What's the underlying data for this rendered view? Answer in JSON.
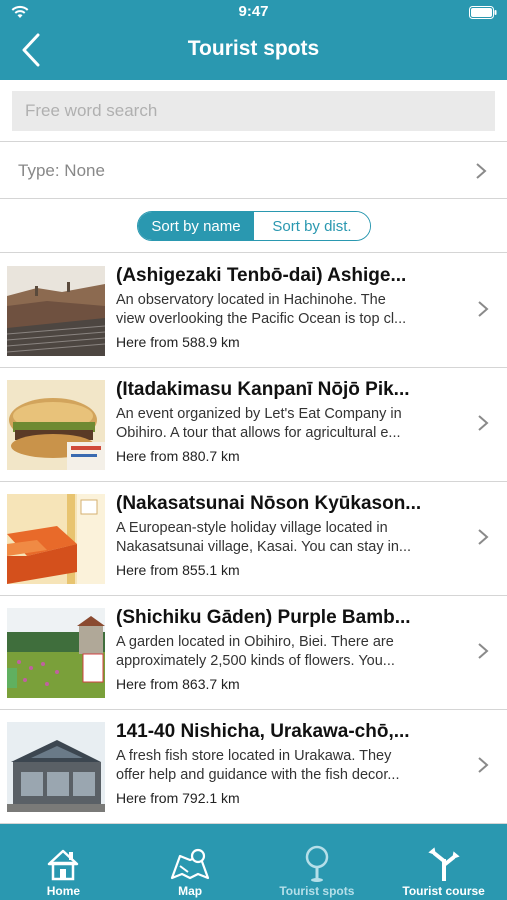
{
  "status": {
    "time": "9:47"
  },
  "nav": {
    "title": "Tourist spots"
  },
  "search": {
    "placeholder": "Free word search",
    "value": ""
  },
  "filter": {
    "type_label": "Type: None"
  },
  "sort": {
    "by_name": "Sort by name",
    "by_dist": "Sort by dist.",
    "selected": "by_name"
  },
  "items": [
    {
      "title": "(Ashigezaki Tenbō-dai) Ashige...",
      "desc1": "An observatory located in Hachinohe. The",
      "desc2": "view overlooking the Pacific Ocean is top cl...",
      "distance": "Here from 588.9 km"
    },
    {
      "title": "(Itadakimasu Kanpanī Nōjō Pik...",
      "desc1": "An event organized by Let's Eat Company in",
      "desc2": "Obihiro. A tour that allows for agricultural e...",
      "distance": "Here from 880.7 km"
    },
    {
      "title": "(Nakasatsunai Nōson Kyūkason...",
      "desc1": "A European-style holiday village located in",
      "desc2": "Nakasatsunai village, Kasai. You can stay in...",
      "distance": "Here from 855.1 km"
    },
    {
      "title": "(Shichiku Gāden) Purple Bamb...",
      "desc1": "A garden located in Obihiro, Biei. There are",
      "desc2": "approximately 2,500 kinds of flowers. You...",
      "distance": "Here from 863.7 km"
    },
    {
      "title": "141-40 Nishicha, Urakawa-chō,...",
      "desc1": "A fresh fish store located in Urakawa. They",
      "desc2": "offer help and guidance with the fish decor...",
      "distance": "Here from 792.1 km"
    }
  ],
  "tabs": [
    {
      "label": "Home",
      "icon": "home-icon"
    },
    {
      "label": "Map",
      "icon": "map-icon"
    },
    {
      "label": "Tourist spots",
      "icon": "pin-icon",
      "selected": true
    },
    {
      "label": "Tourist course",
      "icon": "route-icon"
    }
  ],
  "colors": {
    "accent": "#2a98b0",
    "selected_tab": "#b5dfe9"
  }
}
